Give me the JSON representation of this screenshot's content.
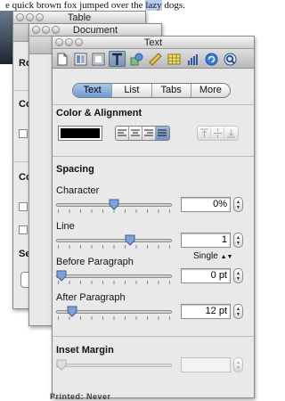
{
  "background": {
    "doc_text_before": "e quick brown fox jumped over the",
    "doc_text_highlight": "lazy",
    "doc_text_after": " dogs."
  },
  "panels": {
    "table": {
      "title": "Table"
    },
    "document": {
      "title": "Document"
    },
    "text": {
      "title": "Text"
    }
  },
  "behind": {
    "labels": [
      "Ro",
      "Co",
      "Co",
      "Se"
    ],
    "bottom_text": "Printed: Never"
  },
  "toolbar": {
    "icons": [
      "document-icon",
      "layout-icon",
      "text-icon",
      "graphic-icon",
      "ruler-icon",
      "table-icon",
      "chart-icon",
      "links-icon",
      "quicktime-icon"
    ],
    "selected": "text-icon"
  },
  "tabs": {
    "items": [
      "Text",
      "List",
      "Tabs",
      "More"
    ],
    "selected": "Text"
  },
  "color_alignment": {
    "header": "Color & Alignment",
    "color": "#000000",
    "horizontal": [
      "align-left",
      "align-center",
      "align-right",
      "justify"
    ],
    "horizontal_selected": "justify",
    "vertical": [
      "align-top",
      "align-middle",
      "align-bottom"
    ]
  },
  "spacing": {
    "header": "Spacing",
    "character": {
      "label": "Character",
      "value": "0%",
      "slider": 0.5
    },
    "line": {
      "label": "Line",
      "value": "1",
      "slider": 0.65,
      "mode": "Single"
    },
    "before_paragraph": {
      "label": "Before Paragraph",
      "value": "0 pt",
      "slider": 0.0
    },
    "after_paragraph": {
      "label": "After Paragraph",
      "value": "12 pt",
      "slider": 0.1
    }
  },
  "inset_margin": {
    "header": "Inset Margin",
    "value": "",
    "slider": 0.0
  },
  "colors": {
    "selection": "#b7cdf0",
    "active_segment": "#7fa6da"
  }
}
